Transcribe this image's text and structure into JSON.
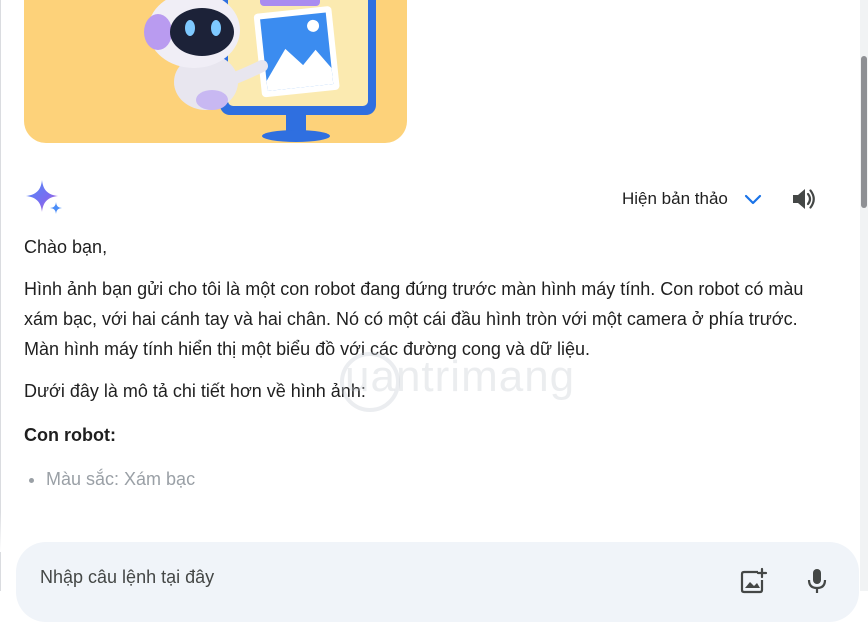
{
  "header": {
    "draft_label": "Hiện bản thảo"
  },
  "icons": {
    "assistant": "gemini-sparkle-icon",
    "drafts": "chevron-down-icon",
    "speak": "speaker-icon",
    "upload": "add-image-icon",
    "voice": "microphone-icon"
  },
  "response": {
    "greeting": "Chào bạn,",
    "body": "Hình ảnh bạn gửi cho tôi là một con robot đang đứng trước màn hình máy tính. Con robot có màu xám bạc, với hai cánh tay và hai chân. Nó có một cái đầu hình tròn với một camera ở phía trước. Màn hình máy tính hiển thị một biểu đồ với các đường cong và dữ liệu.",
    "detail_intro": "Dưới đây là mô tả chi tiết hơn về hình ảnh:",
    "section_title": "Con robot:",
    "bullets": [
      "Màu sắc: Xám bạc"
    ]
  },
  "watermark": "uantrimang",
  "prompt": {
    "placeholder": "Nhập câu lệnh tại đây"
  },
  "colors": {
    "accent": "#1a73e8",
    "image_bg": "#fdd27a",
    "input_bg": "#f0f4f9"
  }
}
